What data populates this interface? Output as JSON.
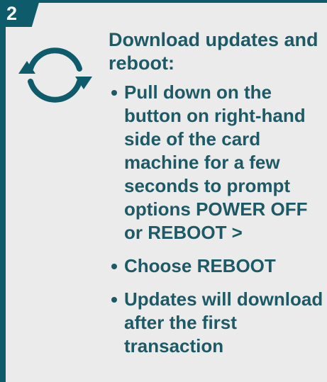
{
  "step": {
    "number": "2"
  },
  "icon": {
    "name": "refresh-icon",
    "color": "#0e5c6b"
  },
  "heading": "Download updates and reboot:",
  "bullets": [
    "Pull down on the button on right-hand side of the card machine for a few seconds to prompt options POWER OFF or REBOOT >",
    "Choose REBOOT",
    "Updates will download after the first transaction"
  ],
  "colors": {
    "accent": "#0e5c6b",
    "text": "#1e5a66",
    "background": "#ebebeb"
  }
}
